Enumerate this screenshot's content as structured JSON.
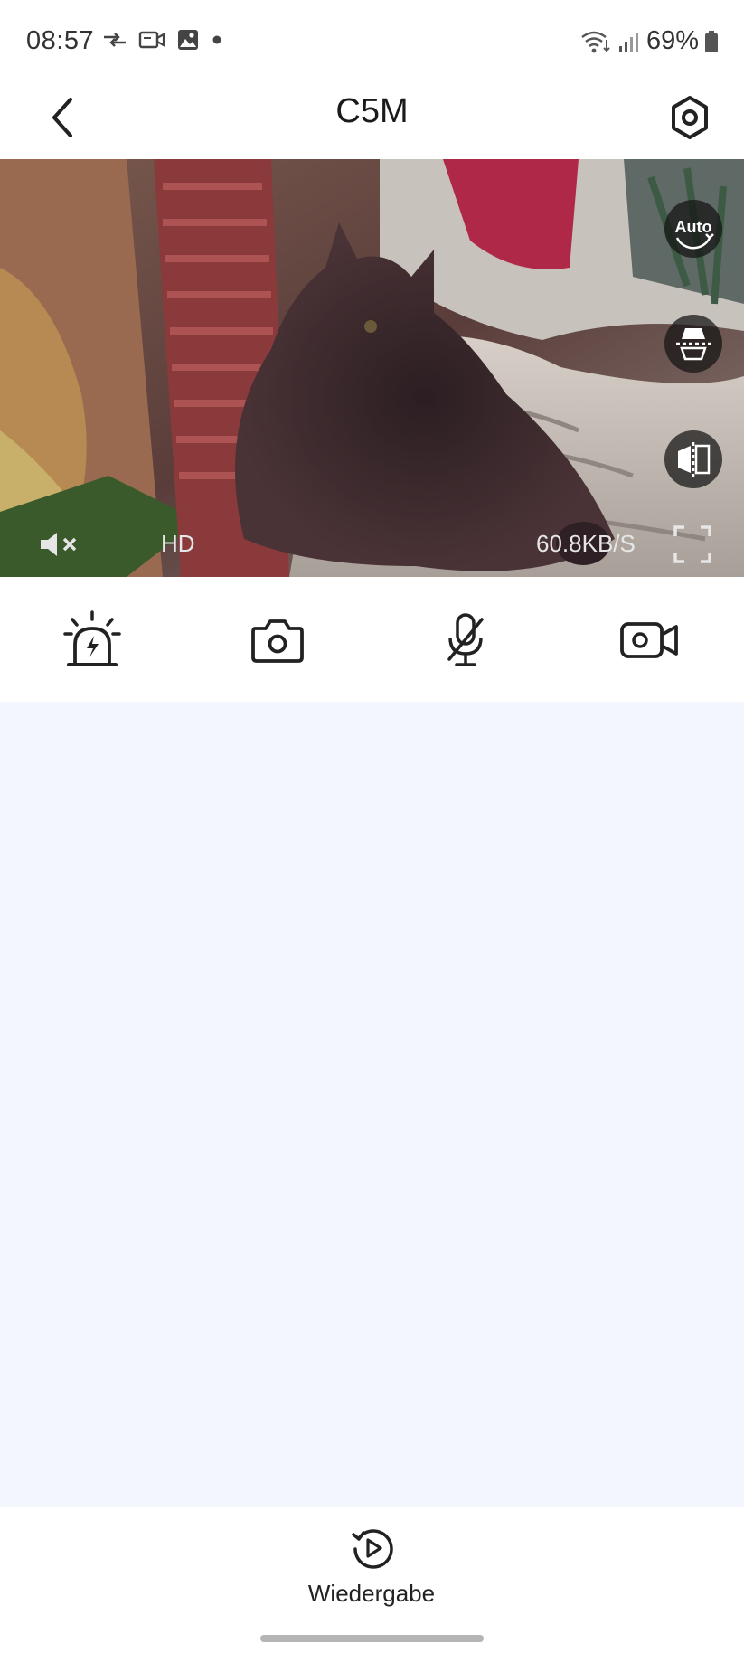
{
  "status_bar": {
    "time": "08:57",
    "battery": "69%",
    "left_icons": [
      "data-transfer-icon",
      "video-call-icon",
      "gallery-icon",
      "notification-dot-icon"
    ],
    "right_icons": [
      "wifi-icon",
      "cell-signal-icon",
      "battery-icon"
    ]
  },
  "header": {
    "title": "C5M",
    "back_icon": "chevron-left-icon",
    "settings_icon": "settings-hexagon-icon"
  },
  "video": {
    "quality": "HD",
    "speed": "60.8KB/S",
    "side_buttons": [
      {
        "name": "auto-mode-button",
        "label": "Auto"
      },
      {
        "name": "flip-vertical-button",
        "icon": "flip-vertical-icon"
      },
      {
        "name": "mirror-button",
        "icon": "mirror-icon"
      }
    ],
    "mute_icon": "speaker-muted-icon",
    "fullscreen_icon": "fullscreen-icon"
  },
  "controls": [
    {
      "name": "siren-button",
      "icon": "siren-icon"
    },
    {
      "name": "snapshot-button",
      "icon": "camera-icon"
    },
    {
      "name": "microphone-button",
      "icon": "microphone-off-icon"
    },
    {
      "name": "record-button",
      "icon": "video-camera-icon"
    }
  ],
  "footer": {
    "playback_label": "Wiedergabe",
    "playback_icon": "replay-icon"
  },
  "colors": {
    "background": "#f3f7fd",
    "surface": "#ffffff",
    "icon": "#2a2a2a"
  }
}
